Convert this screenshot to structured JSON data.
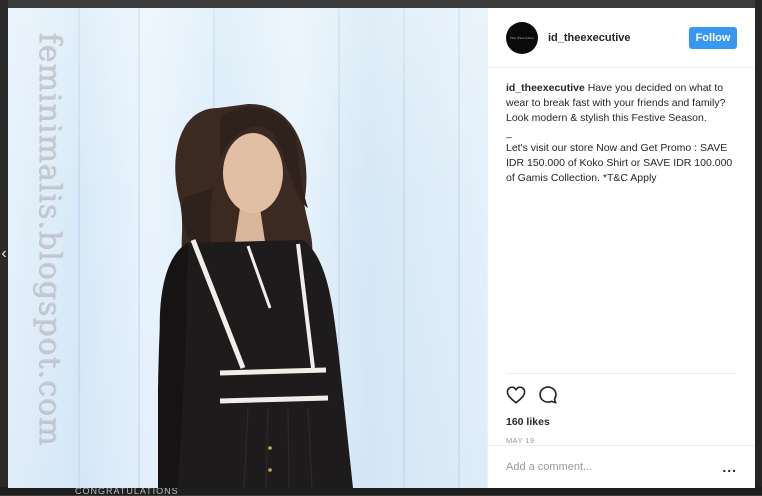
{
  "background": {
    "bottom_text": "CONGRATULATIONS"
  },
  "nav": {
    "prev_icon": "chevron-left-icon",
    "prev_glyph": "‹"
  },
  "photo": {
    "watermark": "feminimalis.blogspot.com"
  },
  "post": {
    "avatar_text": "The Executive",
    "username": "id_theexecutive",
    "follow_label": "Follow",
    "caption_author": "id_theexecutive",
    "caption_lines": [
      "Have you decided on what to wear to break fast with your friends and family?",
      "Look modern & stylish this Festive Season.",
      "_",
      "Let's visit our store Now and Get Promo : SAVE IDR 150.000 of Koko Shirt or SAVE IDR 100.000 of Gamis Collection. *T&C Apply"
    ],
    "likes": "160 likes",
    "date": "MAY 19",
    "comment_placeholder": "Add a comment...",
    "more_label": "..."
  },
  "colors": {
    "accent": "#3897f0",
    "text": "#262626",
    "muted": "#999999"
  },
  "icons": {
    "like": "heart-icon",
    "comment": "comment-icon",
    "more": "more-options-icon"
  }
}
